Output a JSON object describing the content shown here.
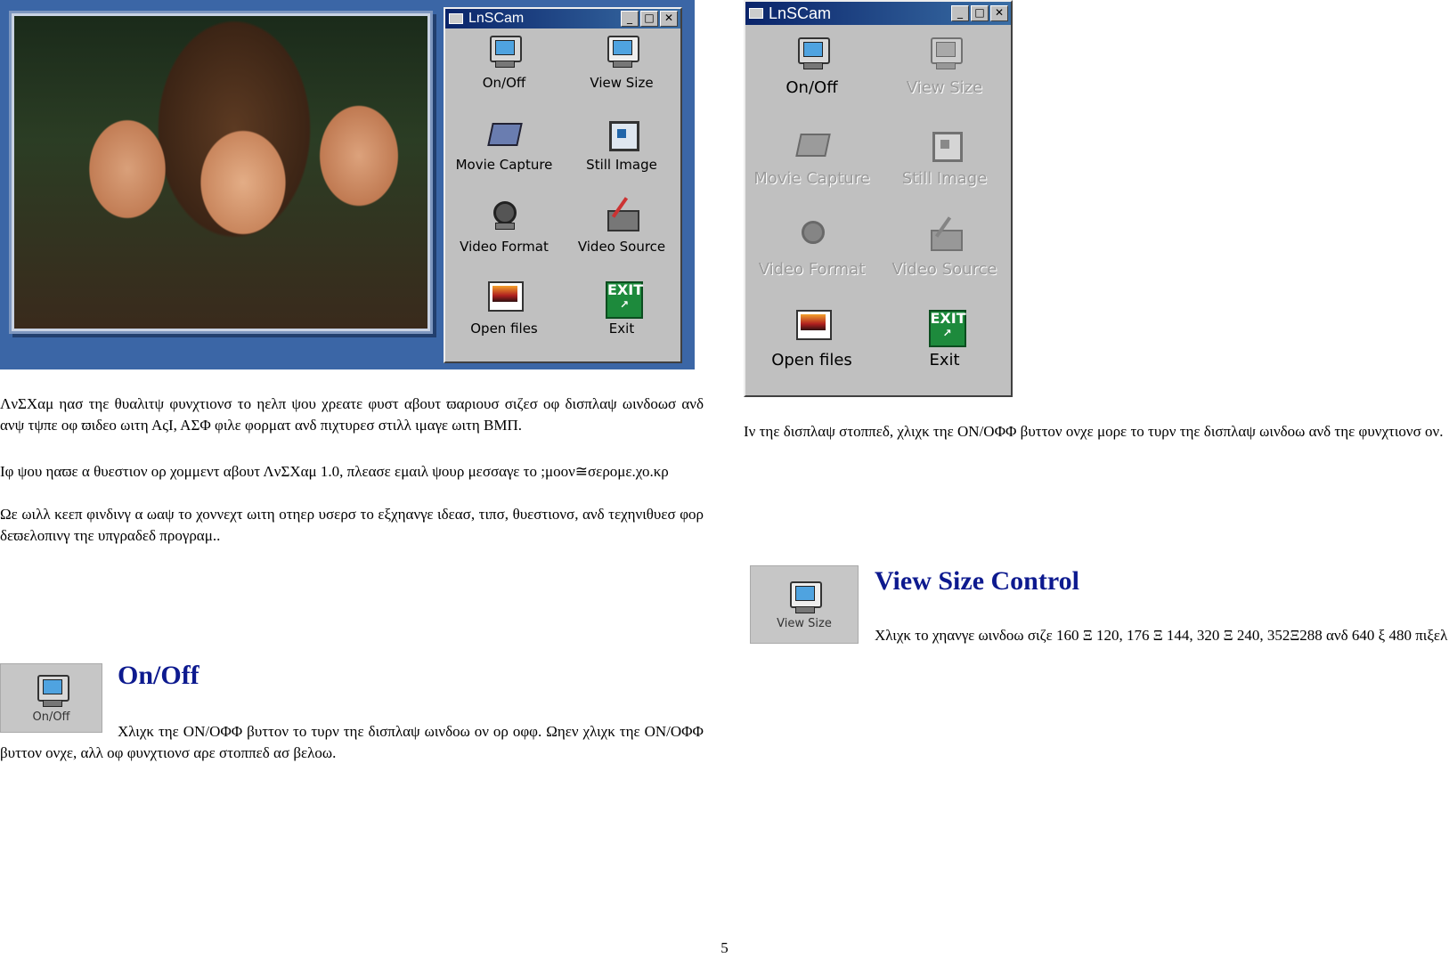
{
  "app_window": {
    "title": "LnSCam",
    "buttons": [
      {
        "label": "On/Off",
        "icon": "monitor-icon",
        "enabled": true
      },
      {
        "label": "View Size",
        "icon": "view-size-icon",
        "enabled": true
      },
      {
        "label": "Movie Capture",
        "icon": "camera-icon",
        "enabled": true
      },
      {
        "label": "Still Image",
        "icon": "picture-frame-icon",
        "enabled": true
      },
      {
        "label": "Video Format",
        "icon": "lens-icon",
        "enabled": true
      },
      {
        "label": "Video Source",
        "icon": "pen-device-icon",
        "enabled": true
      },
      {
        "label": "Open files",
        "icon": "files-icon",
        "enabled": true
      },
      {
        "label": "Exit",
        "icon": "exit-icon",
        "enabled": true
      }
    ]
  },
  "app_window_stopped": {
    "title": "LnSCam",
    "buttons": [
      {
        "label": "On/Off",
        "enabled": true
      },
      {
        "label": "View Size",
        "enabled": false
      },
      {
        "label": "Movie Capture",
        "enabled": false
      },
      {
        "label": "Still Image",
        "enabled": false
      },
      {
        "label": "Video Format",
        "enabled": false
      },
      {
        "label": "Video Source",
        "enabled": false
      },
      {
        "label": "Open files",
        "enabled": true
      },
      {
        "label": "Exit",
        "enabled": true
      }
    ]
  },
  "exit_icon_text": "EXIT",
  "title_buttons": [
    "_",
    "□",
    "✕"
  ],
  "left_text": {
    "intro": "ΛνΣΧαμ ηασ τηε θυαλιτψ φυνχτιονσ το ηελπ ψου χρεατε φυστ αβουτ ϖαριουσ σιζεσ οφ δισπλαψ ωινδοωσ ανδ ανψ τψπε οφ ϖιδεο ωιτη ΑςΙ, ΑΣΦ φιλε φορματ ανδ πιχτυρεσ στιλλ ιμαγε ωιτη ΒΜΠ.",
    "contact": "Ιφ ψου ηαϖε α θυεστιον ορ χομμεντ αβουτ ΛνΣΧαμ 1.0, πλεασε εμαιλ ψουρ μεσσαγε το ;μοον≅σερομε.χο.κρ",
    "closing": "Ωε ωιλλ κεεπ φινδινγ α ωαψ το χοννεχτ ωιτη οτηερ υσερσ το εξχηανγε ιδεασ, τιπσ, θυεστιονσ, ανδ τεχηνιθυεσ φορ δεϖελοπινγ τηε υπγραδεδ προγραμ.."
  },
  "onoff_section": {
    "thumb_label": "On/Off",
    "heading": "On/Off",
    "body": "Χλιχκ τηε  ΟΝ/ΟΦΦ  βυττον το τυρν τηε δισπλαψ ωινδοω ον ορ οφφ. Ωηεν χλιχκ τηε  ΟΝ/ΟΦΦ  βυττον ονχε, αλλ οφ φυνχτιονσ αρε στοππεδ ασ βελοω."
  },
  "right_text": {
    "stopped_note": "Ιν τηε δισπλαψ στοππεδ, χλιχκ τηε  ΟΝ/ΟΦΦ  βυττον ονχε μορε το τυρν τηε δισπλαψ ωινδοω ανδ τηε φυνχτιονσ ον."
  },
  "viewsize_section": {
    "thumb_label": "View Size",
    "heading": "View Size Control",
    "body": "Χλιχκ το χηανγε ωινδοω σιζε 160 Ξ 120, 176 Ξ 144, 320 Ξ 240, 352Ξ288 ανδ 640 ξ 480 πιξελ"
  },
  "page_number": "5"
}
